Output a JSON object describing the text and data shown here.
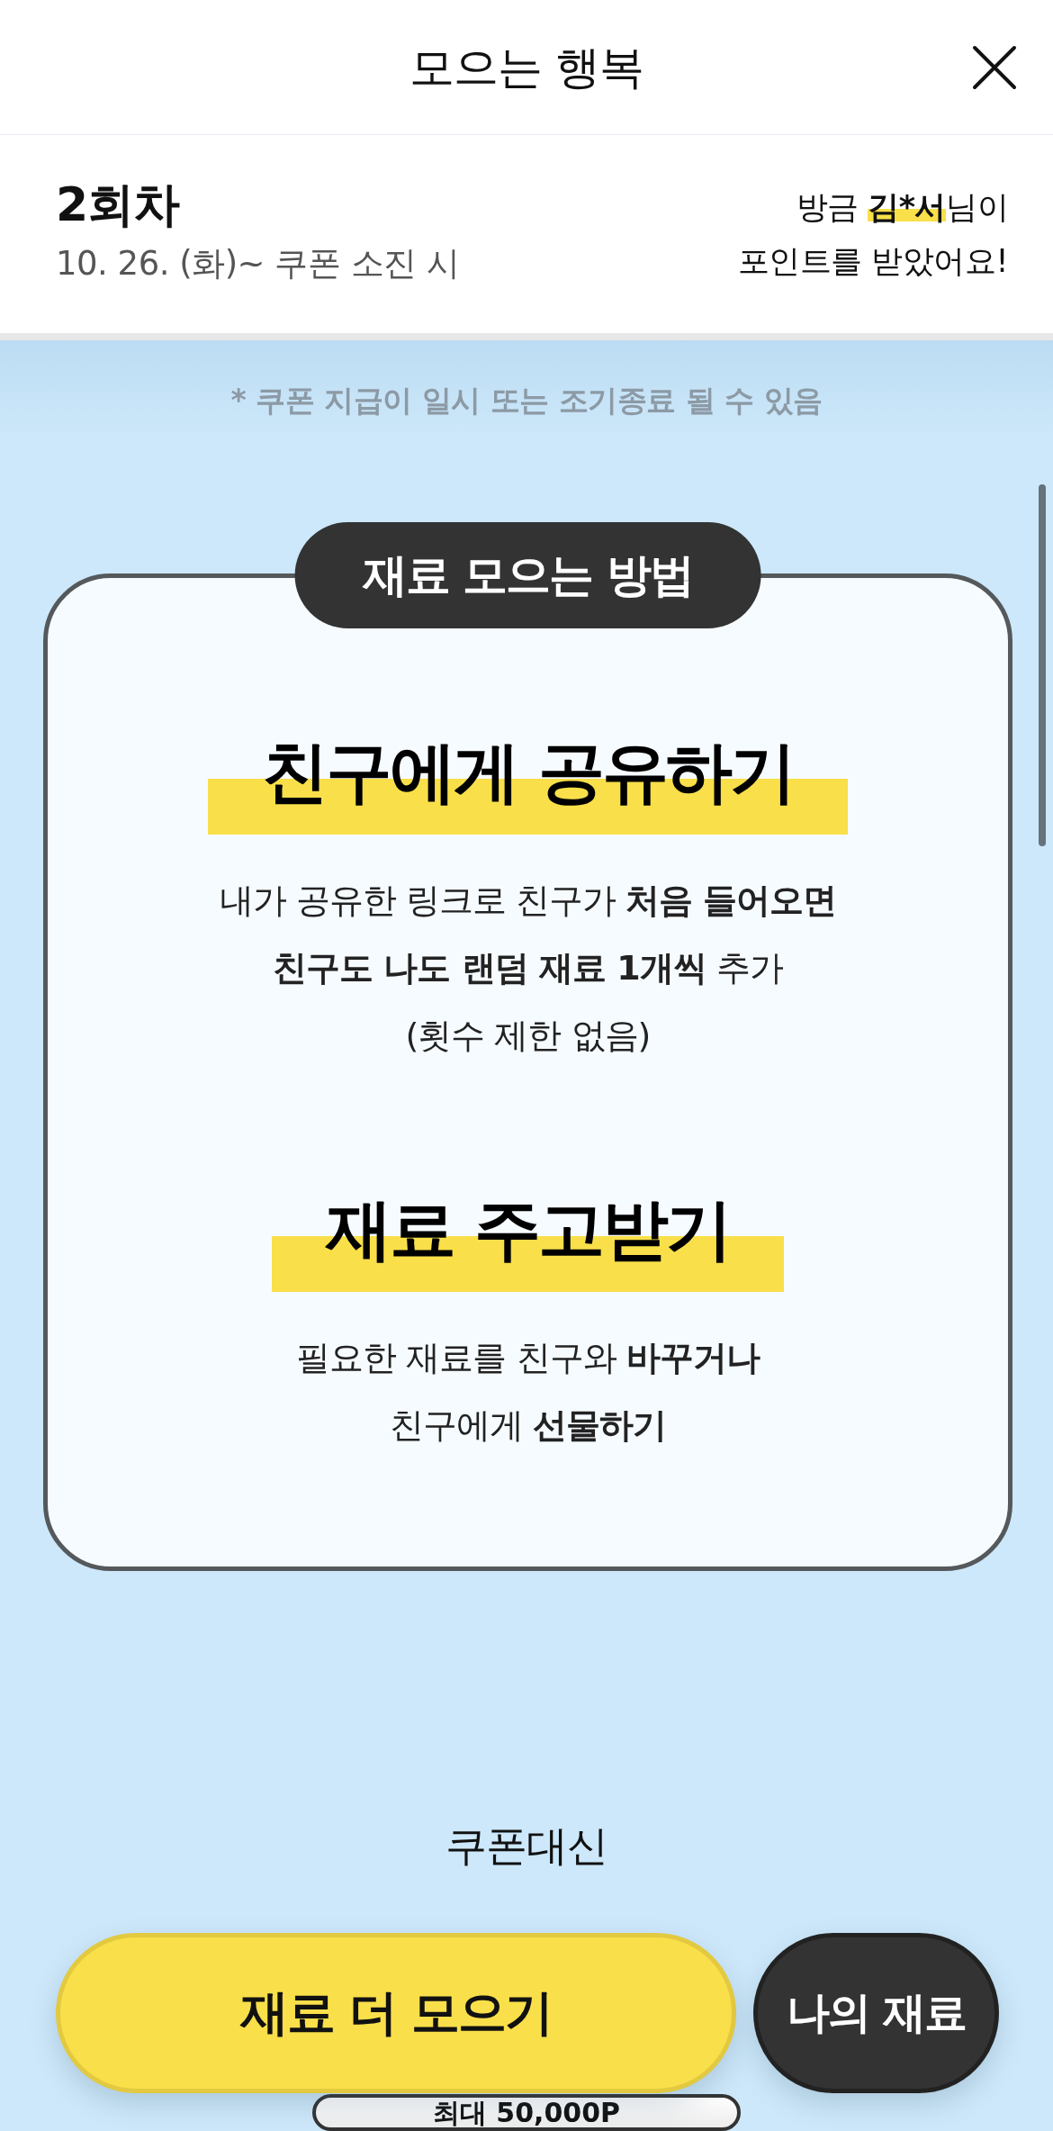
{
  "header": {
    "title": "모으는 행복"
  },
  "round": {
    "label": "2회차",
    "period": "10. 26. (화)~ 쿠폰 소진 시"
  },
  "ticker": {
    "lines": [
      {
        "parts": [
          {
            "text": "방금 ",
            "kind": "plain"
          },
          {
            "text": "김*서",
            "kind": "highlight"
          },
          {
            "text": "님이",
            "kind": "plain"
          }
        ]
      },
      {
        "parts": [
          {
            "text": "포인트를 받았어요!",
            "kind": "plain"
          }
        ]
      }
    ]
  },
  "notice": "* 쿠폰 지급이 일시 또는 조기종료 될 수 있음",
  "guide": {
    "tag": "재료 모으는 방법",
    "methods": [
      {
        "title": "친구에게 공유하기",
        "lines": [
          "내가 공유한 링크로 친구가 **처음 들어오면**",
          "**친구도 나도 랜덤 재료 1개씩** 추가",
          "(횟수 제한 없음)"
        ]
      },
      {
        "title": "재료 주고받기",
        "lines": [
          "필요한 재료를 친구와 **바꾸거나**",
          "친구에게 **선물하기**"
        ]
      }
    ]
  },
  "promo": {
    "subtitle": "쿠폰대신",
    "badge": "최대 50,000P"
  },
  "actions": [
    {
      "label": "재료 더 모으기",
      "kind": "primary"
    },
    {
      "label": "나의 재료",
      "kind": "secondary"
    }
  ]
}
